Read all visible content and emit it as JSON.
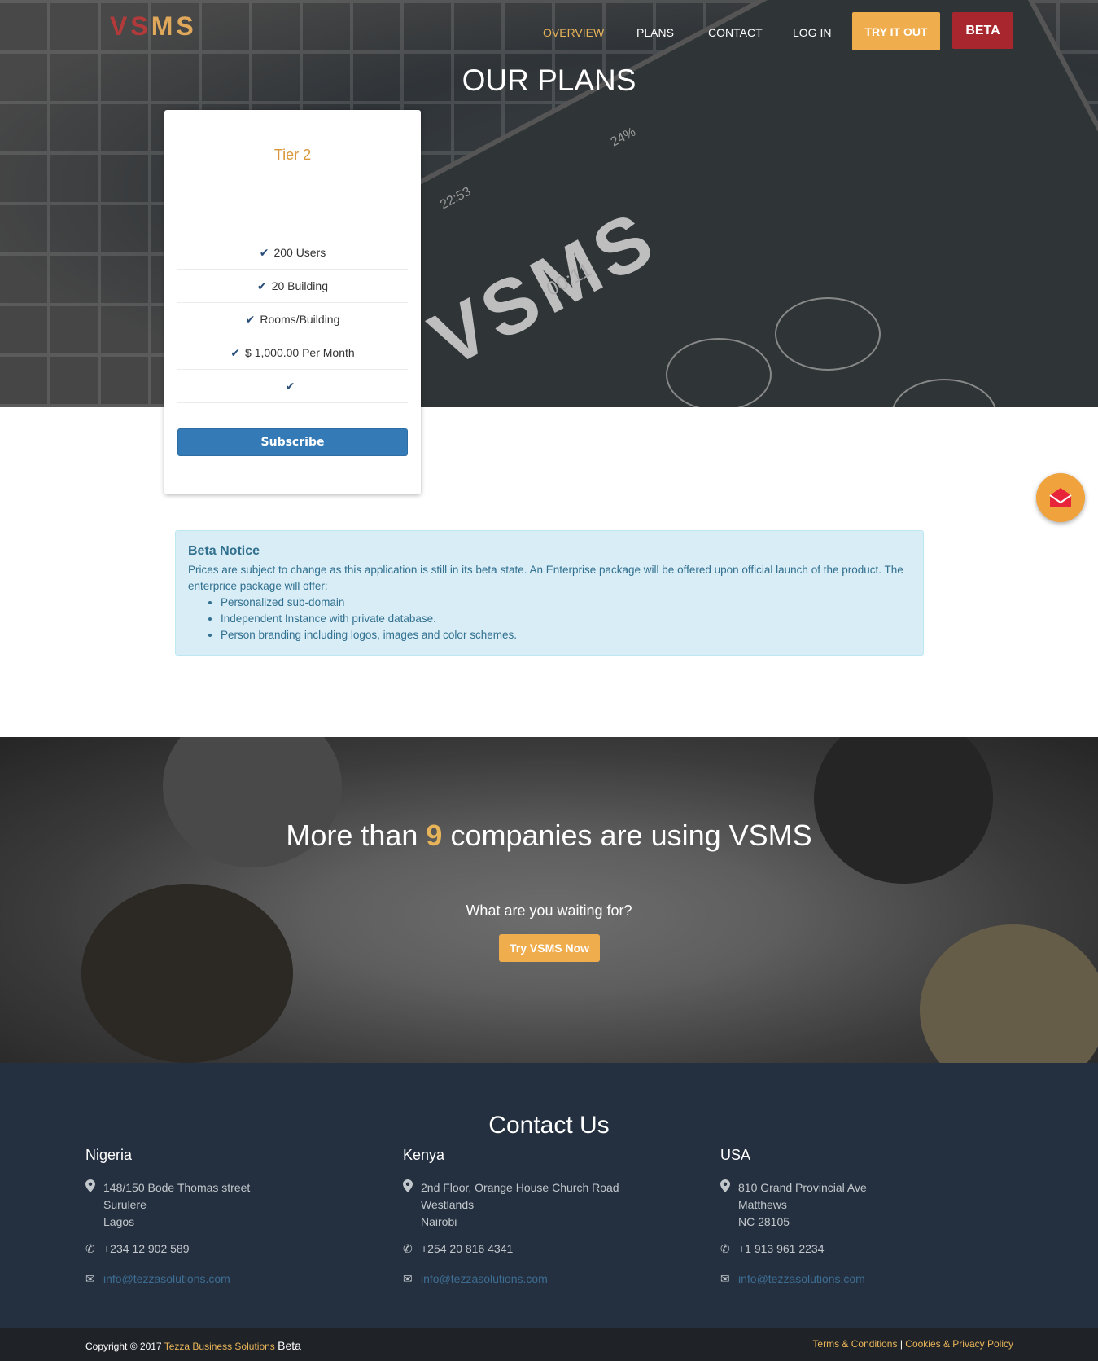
{
  "brand": {
    "logo_vs": "VS",
    "logo_ms": "MS"
  },
  "nav": {
    "overview": "OVERVIEW",
    "plans": "PLANS",
    "contact": "CONTACT",
    "login": "LOG IN",
    "try": "TRY IT OUT",
    "beta": "BETA"
  },
  "hero": {
    "title": "OUR PLANS",
    "phone_logo": "VSMS",
    "phone_time": "00:11",
    "phone_clock": "22:53",
    "phone_battery": "24%"
  },
  "plan": {
    "name": "Tier 2",
    "features": [
      "200 Users",
      "20 Building",
      "Rooms/Building",
      "$ 1,000.00 Per Month",
      ""
    ],
    "subscribe": "Subscribe"
  },
  "notice": {
    "title": "Beta Notice",
    "text": "Prices are subject to change as this application is still in its beta state. An Enterprise package will be offered upon official launch of the product. The enterprice package will offer:",
    "items": [
      "Personalized sub-domain",
      "Independent Instance with private database.",
      "Person branding including logos, images and color schemes."
    ]
  },
  "companies": {
    "title_pre": "More than ",
    "count": "9",
    "title_post": " companies are using VSMS",
    "subtitle": "What are you waiting for?",
    "button": "Try VSMS Now"
  },
  "contact": {
    "title": "Contact Us",
    "offices": [
      {
        "country": "Nigeria",
        "address": [
          "148/150 Bode Thomas street",
          "Surulere",
          "Lagos"
        ],
        "phone": "+234 12 902 589",
        "email": "info@tezzasolutions.com"
      },
      {
        "country": "Kenya",
        "address": [
          "2nd Floor, Orange House Church Road",
          "Westlands",
          "Nairobi"
        ],
        "phone": "+254 20 816 4341",
        "email": "info@tezzasolutions.com"
      },
      {
        "country": "USA",
        "address": [
          "810 Grand Provincial Ave",
          "Matthews",
          "NC 28105"
        ],
        "phone": "+1 913 961 2234",
        "email": "info@tezzasolutions.com"
      }
    ]
  },
  "footer": {
    "copyright": "Copyright",
    "symbol": "©",
    "year": "2017",
    "org": "Tezza Business Solutions",
    "beta": "Beta",
    "terms": "Terms & Conditions",
    "separator": "|",
    "privacy": "Cookies & Privacy Policy"
  },
  "colors": {
    "accent": "#f0ad4e",
    "beta": "#a8262e",
    "primary": "#337ab7",
    "contact_bg": "#24303f"
  }
}
